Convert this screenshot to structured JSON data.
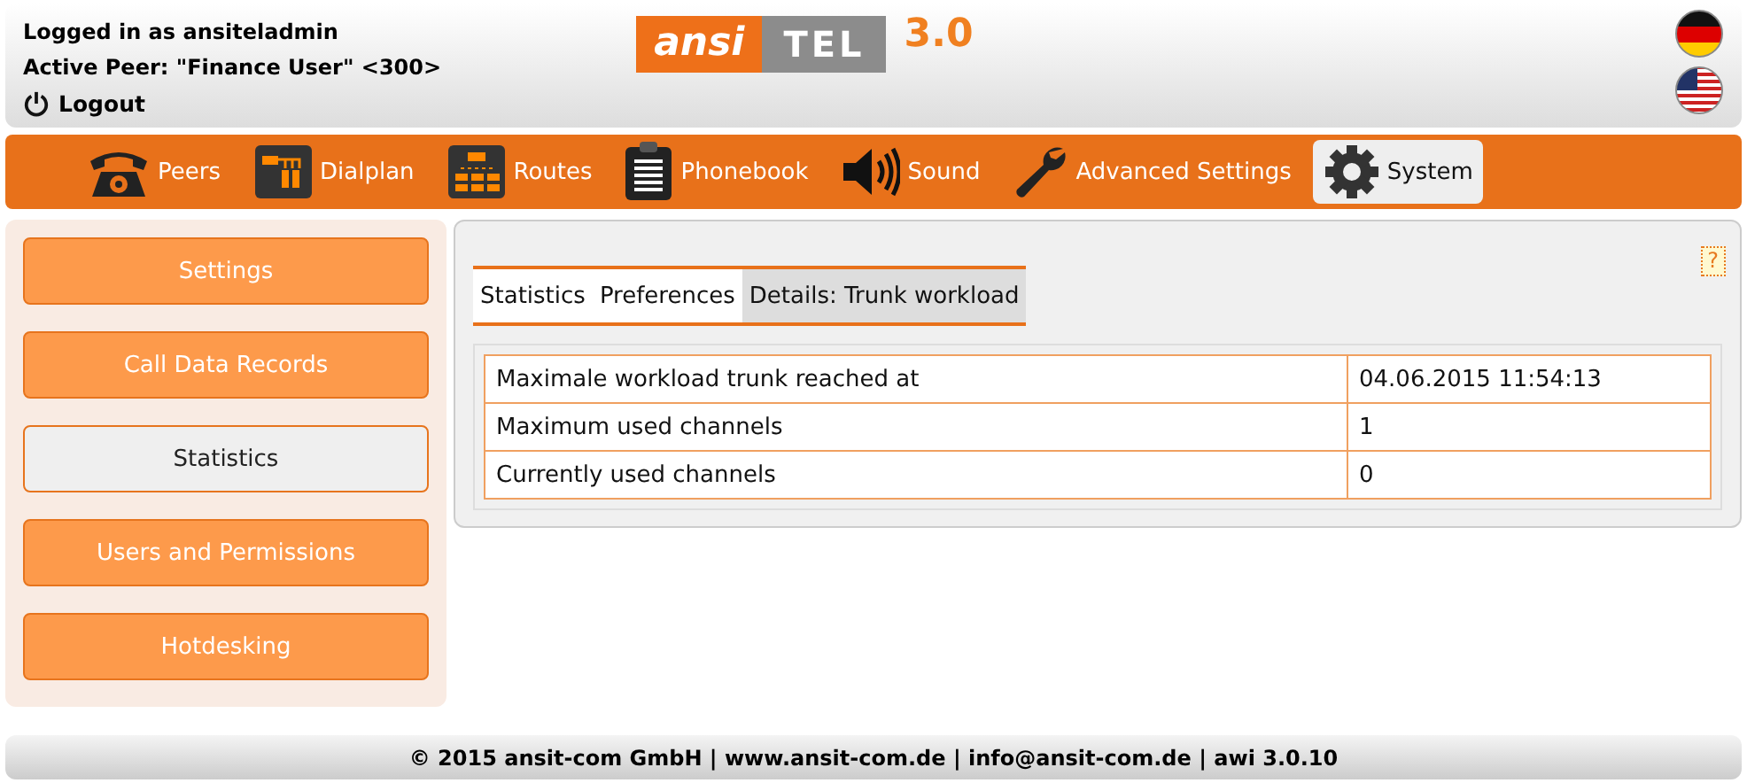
{
  "header": {
    "user_line": "Logged in as ansiteladmin",
    "peer_line": "Active Peer: \"Finance User\" <300>",
    "logout": "Logout",
    "logo": {
      "left": "ansi",
      "right": "TEL",
      "version": "3.0"
    },
    "languages": [
      {
        "kind": "german"
      },
      {
        "kind": "english"
      }
    ]
  },
  "nav": [
    {
      "label": "Peers",
      "kind": "phone",
      "selected": false
    },
    {
      "label": "Dialplan",
      "kind": "dialplan",
      "selected": false
    },
    {
      "label": "Routes",
      "kind": "routes",
      "selected": false
    },
    {
      "label": "Phonebook",
      "kind": "phonebook",
      "selected": false
    },
    {
      "label": "Sound",
      "kind": "sound",
      "selected": false
    },
    {
      "label": "Advanced Settings",
      "kind": "wrench",
      "selected": false
    },
    {
      "label": "System",
      "kind": "gear",
      "selected": true
    }
  ],
  "sidebar": [
    {
      "label": "Settings",
      "selected": false
    },
    {
      "label": "Call Data Records",
      "selected": false
    },
    {
      "label": "Statistics",
      "selected": true
    },
    {
      "label": "Users and Permissions",
      "selected": false
    },
    {
      "label": "Hotdesking",
      "selected": false
    }
  ],
  "help": "?",
  "tabs": [
    {
      "label": "Statistics",
      "selected": false
    },
    {
      "label": "Preferences",
      "selected": false
    },
    {
      "label": "Details: Trunk workload",
      "selected": true
    }
  ],
  "table": {
    "rows": [
      [
        "Maximale workload trunk reached at",
        "04.06.2015 11:54:13"
      ],
      [
        "Maximum used channels",
        "1"
      ],
      [
        "Currently used channels",
        "0"
      ]
    ]
  },
  "footer": "© 2015 ansit-com GmbH | www.ansit-com.de | info@ansit-com.de | awi 3.0.10"
}
